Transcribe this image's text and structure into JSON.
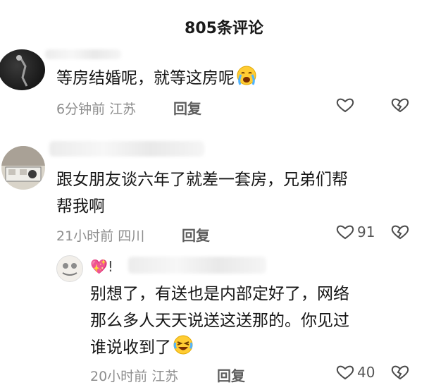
{
  "header": {
    "title": "805条评论"
  },
  "comments": [
    {
      "text": "等房结婚呢，就等这房呢",
      "emoji": "crying-face",
      "time": "6分钟前",
      "location": "江苏",
      "reply_label": "回复",
      "likes": ""
    },
    {
      "text_line1": "跟女朋友谈六年了就差一套房，兄弟们帮",
      "text_line2": "帮我啊",
      "time": "21小时前",
      "location": "四川",
      "reply_label": "回复",
      "likes": "91"
    }
  ],
  "reply": {
    "badge": "💖!",
    "text_line1": "别想了，有送也是内部定好了，网络",
    "text_line2": "那么多人天天说送这送那的。你见过",
    "text_line3": "谁说收到了",
    "emoji": "laughing-tears-face",
    "time": "20小时前",
    "location": "江苏",
    "reply_label": "回复",
    "likes": "40"
  }
}
